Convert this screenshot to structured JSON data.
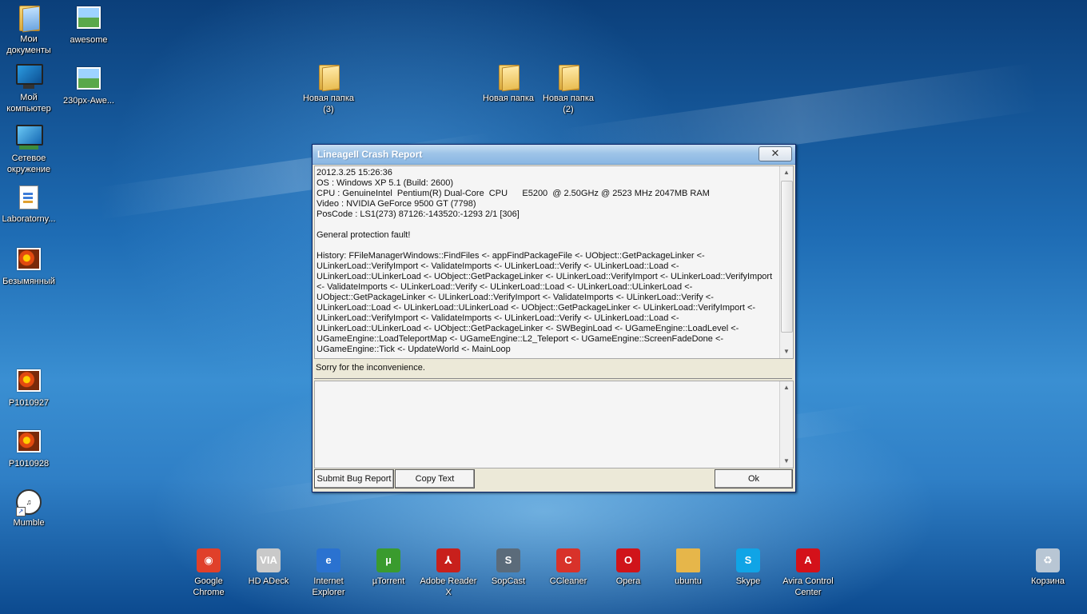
{
  "desktop": {
    "icons_left": [
      {
        "label": "Мои документы",
        "icon": "documents-folder-icon"
      },
      {
        "label": "awesome",
        "icon": "image-file-icon"
      },
      {
        "label": "Мой компьютер",
        "icon": "computer-icon"
      },
      {
        "label": "230px-Awe...",
        "icon": "image-file-icon"
      },
      {
        "label": "Сетевое окружение",
        "icon": "network-icon"
      },
      {
        "label": "Laboratorny...",
        "icon": "document-icon"
      },
      {
        "label": "Безымянный",
        "icon": "image-file-icon"
      },
      {
        "label": "P1010927",
        "icon": "image-file-icon"
      },
      {
        "label": "P1010928",
        "icon": "image-file-icon"
      },
      {
        "label": "Mumble",
        "icon": "mumble-icon"
      }
    ],
    "folders": [
      {
        "label": "Новая папка (3)"
      },
      {
        "label": "Новая папка"
      },
      {
        "label": "Новая папка (2)"
      }
    ],
    "bottom_icons": [
      {
        "label": "Google Chrome",
        "color": "#e0402a",
        "glyph": "◉"
      },
      {
        "label": "HD ADeck",
        "color": "#c9c9c9",
        "glyph": "VIA"
      },
      {
        "label": "Internet Explorer",
        "color": "#2a72d0",
        "glyph": "e"
      },
      {
        "label": "µTorrent",
        "color": "#3a9b2e",
        "glyph": "µ"
      },
      {
        "label": "Adobe Reader X",
        "color": "#c8201c",
        "glyph": "⅄"
      },
      {
        "label": "SopCast",
        "color": "#5b6b7a",
        "glyph": "S"
      },
      {
        "label": "CCleaner",
        "color": "#d8322a",
        "glyph": "C"
      },
      {
        "label": "Opera",
        "color": "#d0141a",
        "glyph": "O"
      },
      {
        "label": "ubuntu",
        "color": "#e6b64a",
        "glyph": ""
      },
      {
        "label": "Skype",
        "color": "#10a4e6",
        "glyph": "S"
      },
      {
        "label": "Avira Control Center",
        "color": "#d4111a",
        "glyph": "A"
      },
      {
        "label": "Корзина",
        "color": "#b8c6d4",
        "glyph": "♻"
      }
    ]
  },
  "dialog": {
    "title": "LineageII Crash Report",
    "close_glyph": "✕",
    "log": "2012.3.25 15:26:36\nOS : Windows XP 5.1 (Build: 2600)\nCPU : GenuineIntel  Pentium(R) Dual-Core  CPU      E5200  @ 2.50GHz @ 2523 MHz 2047MB RAM\nVideo : NVIDIA GeForce 9500 GT (7798)\nPosCode : LS1(273) 87126:-143520:-1293 2/1 [306]\n\nGeneral protection fault!\n\nHistory: FFileManagerWindows::FindFiles <- appFindPackageFile <- UObject::GetPackageLinker <- ULinkerLoad::VerifyImport <- ValidateImports <- ULinkerLoad::Verify <- ULinkerLoad::Load <- ULinkerLoad::ULinkerLoad <- UObject::GetPackageLinker <- ULinkerLoad::VerifyImport <- ULinkerLoad::VerifyImport <- ValidateImports <- ULinkerLoad::Verify <- ULinkerLoad::Load <- ULinkerLoad::ULinkerLoad <- UObject::GetPackageLinker <- ULinkerLoad::VerifyImport <- ValidateImports <- ULinkerLoad::Verify <- ULinkerLoad::Load <- ULinkerLoad::ULinkerLoad <- UObject::GetPackageLinker <- ULinkerLoad::VerifyImport <- ULinkerLoad::VerifyImport <- ValidateImports <- ULinkerLoad::Verify <- ULinkerLoad::Load <- ULinkerLoad::ULinkerLoad <- UObject::GetPackageLinker <- SWBeginLoad <- UGameEngine::LoadLevel <- UGameEngine::LoadTeleportMap <- UGameEngine::L2_Teleport <- UGameEngine::ScreenFadeDone <- UGameEngine::Tick <- UpdateWorld <- MainLoop",
    "sorry_text": "Sorry for the inconvenience.",
    "comment_value": "",
    "buttons": {
      "submit": "Submit Bug Report",
      "copy": "Copy Text",
      "ok": "Ok"
    }
  }
}
